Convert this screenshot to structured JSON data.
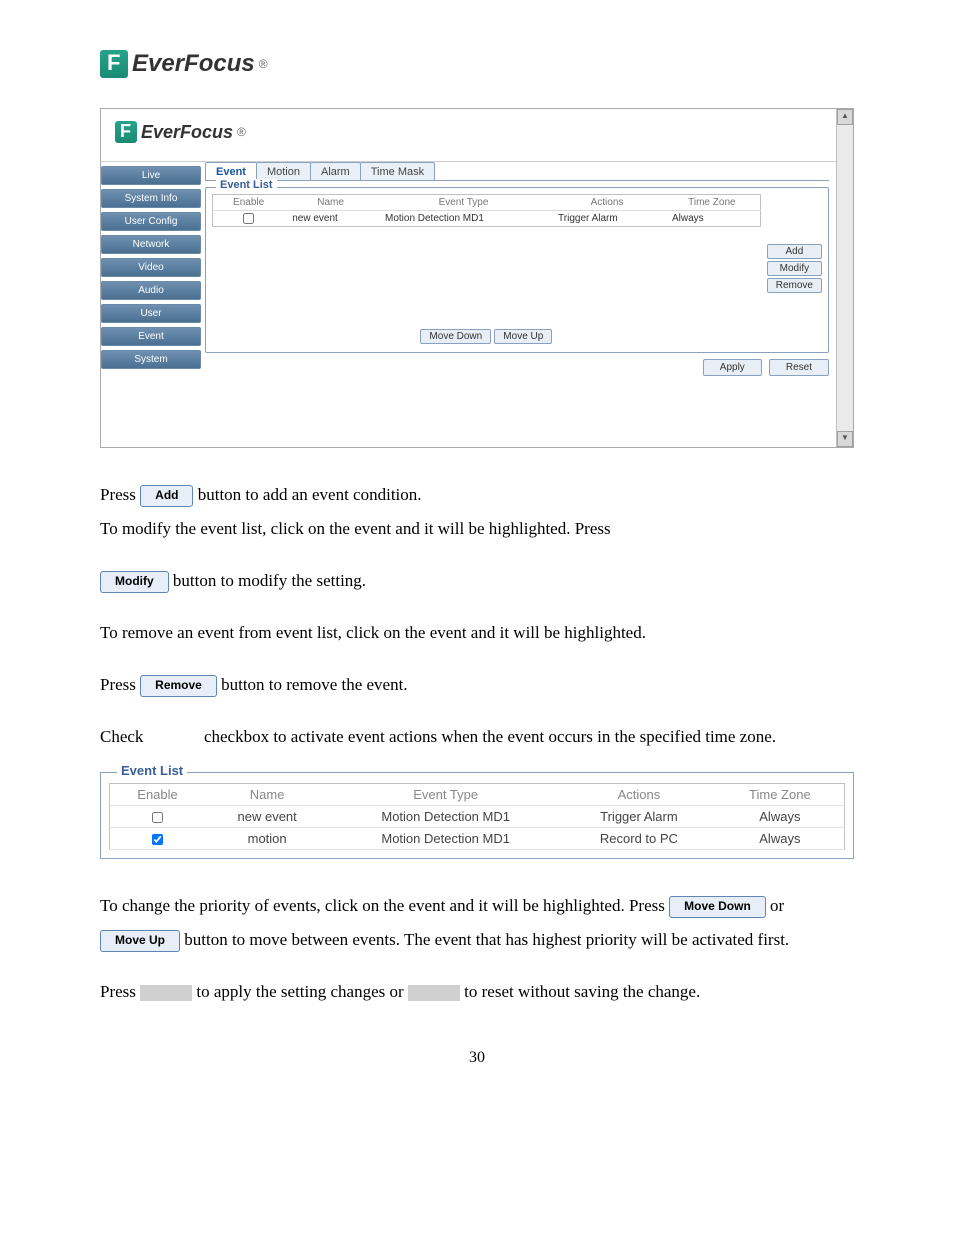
{
  "brand": {
    "name": "EverFocus",
    "symbol": "®"
  },
  "screenshot": {
    "sidebar": [
      "Live",
      "System Info",
      "User Config",
      "Network",
      "Video",
      "Audio",
      "User",
      "Event",
      "System"
    ],
    "tabs": [
      "Event",
      "Motion",
      "Alarm",
      "Time Mask"
    ],
    "active_tab": "Event",
    "legend": "Event List",
    "headers": {
      "enable": "Enable",
      "name": "Name",
      "event_type": "Event Type",
      "actions": "Actions",
      "time_zone": "Time Zone"
    },
    "row": {
      "enable": false,
      "name": "new event",
      "event_type": "Motion Detection MD1",
      "actions": "Trigger Alarm",
      "time_zone": "Always"
    },
    "side_buttons": {
      "add": "Add",
      "modify": "Modify",
      "remove": "Remove"
    },
    "move": {
      "down": "Move Down",
      "up": "Move Up"
    },
    "apply": "Apply",
    "reset": "Reset"
  },
  "body": {
    "p1a": "Press ",
    "p1b": " button to add an event condition.",
    "p2": "To modify the event list, click on the event and it will be highlighted. Press",
    "p3": " button to modify the setting.",
    "p4": "To remove an event from event list, click on the event and it will be highlighted.",
    "p5a": "Press ",
    "p5b": " button to remove the event.",
    "p6a": "Check ",
    "p6b": " checkbox to activate event actions when the event occurs in the specified time zone.",
    "p7": "To change the priority of events, click on the event and it will be highlighted. Press ",
    "p8a": " or ",
    "p8b": " button to move between events. The event that has highest priority will be activated first.",
    "p9a": "Press ",
    "p9b": " to apply the setting changes or ",
    "p9c": " to reset without saving the change.",
    "btn_add": "Add",
    "btn_modify": "Modify",
    "btn_remove": "Remove",
    "btn_move_down": "Move Down",
    "btn_move_up": "Move Up"
  },
  "eventlist2": {
    "legend": "Event List",
    "headers": {
      "enable": "Enable",
      "name": "Name",
      "event_type": "Event Type",
      "actions": "Actions",
      "time_zone": "Time Zone"
    },
    "rows": [
      {
        "enable": false,
        "name": "new event",
        "event_type": "Motion Detection MD1",
        "actions": "Trigger Alarm",
        "time_zone": "Always"
      },
      {
        "enable": true,
        "name": "motion",
        "event_type": "Motion Detection MD1",
        "actions": "Record to PC",
        "time_zone": "Always"
      }
    ]
  },
  "page_number": "30"
}
